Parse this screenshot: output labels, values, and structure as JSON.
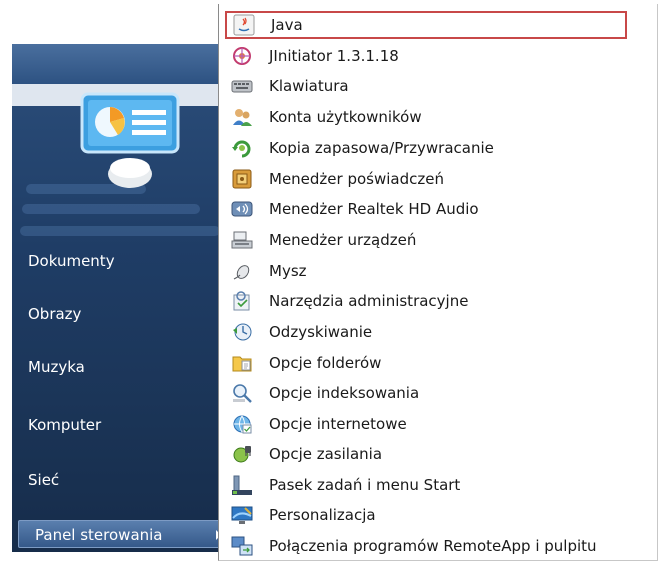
{
  "left_menu": {
    "items": [
      {
        "label": "Dokumenty"
      },
      {
        "label": "Obrazy"
      },
      {
        "label": "Muzyka"
      },
      {
        "label": "Komputer"
      },
      {
        "label": "Sieć"
      },
      {
        "label": "Panel sterowania",
        "selected": true
      }
    ]
  },
  "flyout": {
    "items": [
      {
        "label": "Java",
        "icon": "java-icon",
        "selected": true
      },
      {
        "label": "JInitiator 1.3.1.18",
        "icon": "jinitiator-icon"
      },
      {
        "label": "Klawiatura",
        "icon": "keyboard-icon"
      },
      {
        "label": "Konta użytkowników",
        "icon": "user-accounts-icon"
      },
      {
        "label": "Kopia zapasowa/Przywracanie",
        "icon": "backup-restore-icon"
      },
      {
        "label": "Menedżer poświadczeń",
        "icon": "credential-manager-icon"
      },
      {
        "label": "Menedżer Realtek HD Audio",
        "icon": "realtek-audio-icon"
      },
      {
        "label": "Menedżer urządzeń",
        "icon": "device-manager-icon"
      },
      {
        "label": "Mysz",
        "icon": "mouse-icon"
      },
      {
        "label": "Narzędzia administracyjne",
        "icon": "admin-tools-icon"
      },
      {
        "label": "Odzyskiwanie",
        "icon": "recovery-icon"
      },
      {
        "label": "Opcje folderów",
        "icon": "folder-options-icon"
      },
      {
        "label": "Opcje indeksowania",
        "icon": "indexing-options-icon"
      },
      {
        "label": "Opcje internetowe",
        "icon": "internet-options-icon"
      },
      {
        "label": "Opcje zasilania",
        "icon": "power-options-icon"
      },
      {
        "label": "Pasek zadań i menu Start",
        "icon": "taskbar-icon"
      },
      {
        "label": "Personalizacja",
        "icon": "personalization-icon"
      },
      {
        "label": "Połączenia programów RemoteApp i pulpitu",
        "icon": "remoteapp-icon"
      }
    ]
  },
  "colors": {
    "selection_border": "#c84848",
    "start_pane": "#1f3d66",
    "selected_left": "#35598a"
  }
}
